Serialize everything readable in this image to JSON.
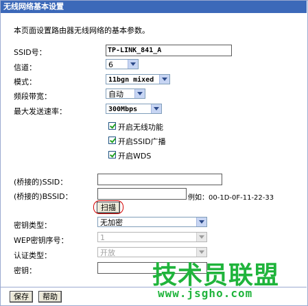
{
  "window_title": "无线网络基本设置",
  "intro": "本页面设置路由器无线网络的基本参数。",
  "ssid": {
    "label": "SSID号：",
    "value": "TP-LINK_841_A"
  },
  "channel": {
    "label": "信道：",
    "value": "6"
  },
  "mode": {
    "label": "模式：",
    "value": "11bgn mixed"
  },
  "bandwidth": {
    "label": "频段带宽：",
    "value": "自动"
  },
  "max_rate": {
    "label": "最大发送速率：",
    "value": "300Mbps"
  },
  "checkboxes": [
    {
      "label": "开启无线功能",
      "checked": true
    },
    {
      "label": "开启SSID广播",
      "checked": true
    },
    {
      "label": "开启WDS",
      "checked": true
    }
  ],
  "bridge_ssid": {
    "label": "(桥接的)SSID：",
    "value": ""
  },
  "bridge_bssid": {
    "label": "(桥接的)BSSID：",
    "value": "",
    "example": "例如：00-1D-0F-11-22-33"
  },
  "scan_button": "扫描",
  "key_type": {
    "label": "密钥类型：",
    "value": "无加密"
  },
  "wep_index": {
    "label": "WEP密钥序号：",
    "value": "1"
  },
  "auth_type": {
    "label": "认证类型：",
    "value": "开放"
  },
  "key": {
    "label": "密钥：",
    "value": ""
  },
  "buttons": {
    "save": "保存",
    "help": "帮助"
  },
  "watermark": {
    "text": "技术员联盟",
    "url": "www.jsgho.com"
  }
}
